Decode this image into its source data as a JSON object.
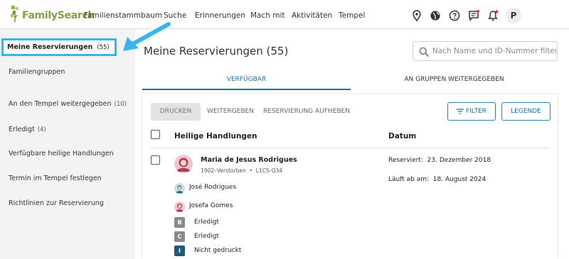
{
  "app": {
    "logo_text": "FamilySearch",
    "brand_color": "#7fa43a",
    "accent_color": "#38b6ec"
  },
  "nav": {
    "items": [
      "Familienstammbaum",
      "Suche",
      "Erinnerungen",
      "Mach mit",
      "Aktivitäten",
      "Tempel"
    ],
    "icons": [
      "map-pin-icon",
      "globe-icon",
      "help-icon",
      "messages-icon",
      "notifications-icon"
    ],
    "avatar_letter": "P"
  },
  "sidebar": {
    "active": {
      "label": "Meine Reservierungen",
      "count": "(55)"
    },
    "items": [
      {
        "label": "Familiengruppen",
        "count": ""
      },
      {
        "label": "An den Tempel weitergegeben",
        "count": "(10)"
      },
      {
        "label": "Erledigt",
        "count": "(4)"
      },
      {
        "label": "Verfügbare heilige Handlungen",
        "count": ""
      },
      {
        "label": "Termin im Tempel festlegen",
        "count": ""
      },
      {
        "label": "Richtlinien zur Reservierung",
        "count": ""
      }
    ]
  },
  "main": {
    "title": "Meine Reservierungen (55)",
    "search_placeholder": "Nach Name und ID-Nummer filtern",
    "tabs": [
      "VERFÜGBAR",
      "AN GRUPPEN WEITERGEGEBEN"
    ],
    "toolbar": {
      "print": "DRUCKEN",
      "share": "WEITERGEBEN",
      "unreserve": "RESERVIERUNG AUFHEBEN",
      "filter": "FILTER",
      "legend": "LEGENDE"
    },
    "columns": {
      "ordinances": "Heilige Handlungen",
      "date": "Datum"
    },
    "record": {
      "name": "Maria de Jesus Rodrigues",
      "lifespan": "1902–Verstorben",
      "id": "L1CS-Q34",
      "reserved_label": "Reserviert:",
      "reserved_date": "23. Dezember 2018",
      "expires_label": "Läuft ab am:",
      "expires_date": "18. August 2024",
      "father": "José Rodrigues",
      "mother": "Josefa Gomes",
      "ordinances": [
        {
          "letter": "B",
          "status": "Erledigt",
          "color": "#8a8a8a"
        },
        {
          "letter": "C",
          "status": "Erledigt",
          "color": "#8a8a8a"
        },
        {
          "letter": "I",
          "status": "Nicht gedruckt",
          "color": "#1d5a7a"
        }
      ]
    }
  }
}
